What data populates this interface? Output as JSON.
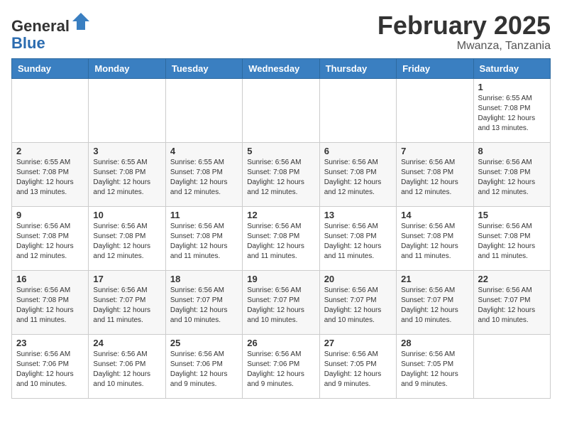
{
  "header": {
    "logo_line1": "General",
    "logo_line2": "Blue",
    "month_title": "February 2025",
    "location": "Mwanza, Tanzania"
  },
  "days_of_week": [
    "Sunday",
    "Monday",
    "Tuesday",
    "Wednesday",
    "Thursday",
    "Friday",
    "Saturday"
  ],
  "weeks": [
    [
      {
        "day": "",
        "info": ""
      },
      {
        "day": "",
        "info": ""
      },
      {
        "day": "",
        "info": ""
      },
      {
        "day": "",
        "info": ""
      },
      {
        "day": "",
        "info": ""
      },
      {
        "day": "",
        "info": ""
      },
      {
        "day": "1",
        "info": "Sunrise: 6:55 AM\nSunset: 7:08 PM\nDaylight: 12 hours\nand 13 minutes."
      }
    ],
    [
      {
        "day": "2",
        "info": "Sunrise: 6:55 AM\nSunset: 7:08 PM\nDaylight: 12 hours\nand 13 minutes."
      },
      {
        "day": "3",
        "info": "Sunrise: 6:55 AM\nSunset: 7:08 PM\nDaylight: 12 hours\nand 12 minutes."
      },
      {
        "day": "4",
        "info": "Sunrise: 6:55 AM\nSunset: 7:08 PM\nDaylight: 12 hours\nand 12 minutes."
      },
      {
        "day": "5",
        "info": "Sunrise: 6:56 AM\nSunset: 7:08 PM\nDaylight: 12 hours\nand 12 minutes."
      },
      {
        "day": "6",
        "info": "Sunrise: 6:56 AM\nSunset: 7:08 PM\nDaylight: 12 hours\nand 12 minutes."
      },
      {
        "day": "7",
        "info": "Sunrise: 6:56 AM\nSunset: 7:08 PM\nDaylight: 12 hours\nand 12 minutes."
      },
      {
        "day": "8",
        "info": "Sunrise: 6:56 AM\nSunset: 7:08 PM\nDaylight: 12 hours\nand 12 minutes."
      }
    ],
    [
      {
        "day": "9",
        "info": "Sunrise: 6:56 AM\nSunset: 7:08 PM\nDaylight: 12 hours\nand 12 minutes."
      },
      {
        "day": "10",
        "info": "Sunrise: 6:56 AM\nSunset: 7:08 PM\nDaylight: 12 hours\nand 12 minutes."
      },
      {
        "day": "11",
        "info": "Sunrise: 6:56 AM\nSunset: 7:08 PM\nDaylight: 12 hours\nand 11 minutes."
      },
      {
        "day": "12",
        "info": "Sunrise: 6:56 AM\nSunset: 7:08 PM\nDaylight: 12 hours\nand 11 minutes."
      },
      {
        "day": "13",
        "info": "Sunrise: 6:56 AM\nSunset: 7:08 PM\nDaylight: 12 hours\nand 11 minutes."
      },
      {
        "day": "14",
        "info": "Sunrise: 6:56 AM\nSunset: 7:08 PM\nDaylight: 12 hours\nand 11 minutes."
      },
      {
        "day": "15",
        "info": "Sunrise: 6:56 AM\nSunset: 7:08 PM\nDaylight: 12 hours\nand 11 minutes."
      }
    ],
    [
      {
        "day": "16",
        "info": "Sunrise: 6:56 AM\nSunset: 7:08 PM\nDaylight: 12 hours\nand 11 minutes."
      },
      {
        "day": "17",
        "info": "Sunrise: 6:56 AM\nSunset: 7:07 PM\nDaylight: 12 hours\nand 11 minutes."
      },
      {
        "day": "18",
        "info": "Sunrise: 6:56 AM\nSunset: 7:07 PM\nDaylight: 12 hours\nand 10 minutes."
      },
      {
        "day": "19",
        "info": "Sunrise: 6:56 AM\nSunset: 7:07 PM\nDaylight: 12 hours\nand 10 minutes."
      },
      {
        "day": "20",
        "info": "Sunrise: 6:56 AM\nSunset: 7:07 PM\nDaylight: 12 hours\nand 10 minutes."
      },
      {
        "day": "21",
        "info": "Sunrise: 6:56 AM\nSunset: 7:07 PM\nDaylight: 12 hours\nand 10 minutes."
      },
      {
        "day": "22",
        "info": "Sunrise: 6:56 AM\nSunset: 7:07 PM\nDaylight: 12 hours\nand 10 minutes."
      }
    ],
    [
      {
        "day": "23",
        "info": "Sunrise: 6:56 AM\nSunset: 7:06 PM\nDaylight: 12 hours\nand 10 minutes."
      },
      {
        "day": "24",
        "info": "Sunrise: 6:56 AM\nSunset: 7:06 PM\nDaylight: 12 hours\nand 10 minutes."
      },
      {
        "day": "25",
        "info": "Sunrise: 6:56 AM\nSunset: 7:06 PM\nDaylight: 12 hours\nand 9 minutes."
      },
      {
        "day": "26",
        "info": "Sunrise: 6:56 AM\nSunset: 7:06 PM\nDaylight: 12 hours\nand 9 minutes."
      },
      {
        "day": "27",
        "info": "Sunrise: 6:56 AM\nSunset: 7:05 PM\nDaylight: 12 hours\nand 9 minutes."
      },
      {
        "day": "28",
        "info": "Sunrise: 6:56 AM\nSunset: 7:05 PM\nDaylight: 12 hours\nand 9 minutes."
      },
      {
        "day": "",
        "info": ""
      }
    ]
  ]
}
